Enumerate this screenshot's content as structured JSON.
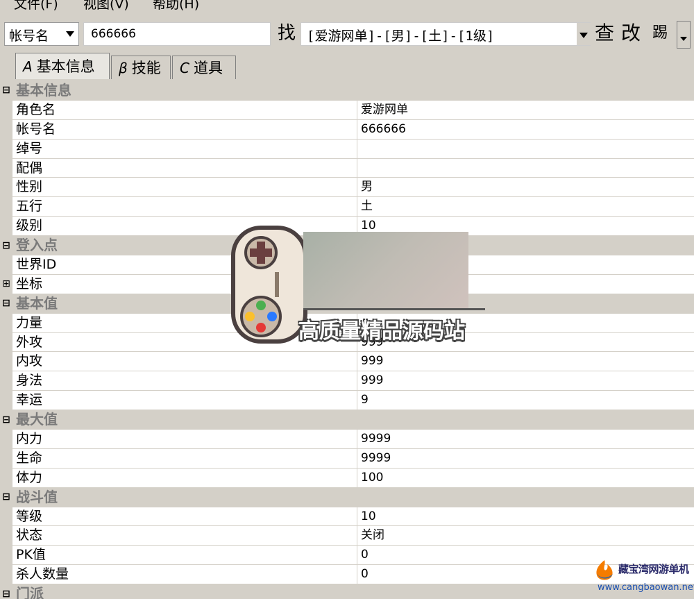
{
  "menu": [
    {
      "label": "文件(F)"
    },
    {
      "label": "视图(V)"
    },
    {
      "label": "帮助(H)"
    }
  ],
  "toolbar": {
    "search_type": "帐号名",
    "account_value": "666666",
    "find_label": "找",
    "role_selected": "[爱游网单]-[男]-[土]-[1级]",
    "query_label": "查",
    "modify_label": "改",
    "extra_label": "踢"
  },
  "tabs": [
    {
      "label": "基本信息",
      "icon": "person-icon",
      "active": true
    },
    {
      "label": "技能",
      "icon": "skill-icon",
      "active": false
    },
    {
      "label": "道具",
      "icon": "item-icon",
      "active": false
    }
  ],
  "grid": {
    "rows": [
      {
        "type": "category",
        "expander": "⊟",
        "name": "基本信息"
      },
      {
        "type": "prop",
        "name": "角色名",
        "value": "爱游网单"
      },
      {
        "type": "prop",
        "name": "帐号名",
        "value": "666666"
      },
      {
        "type": "prop",
        "name": "绰号",
        "value": ""
      },
      {
        "type": "prop",
        "name": "配偶",
        "value": ""
      },
      {
        "type": "prop",
        "name": "性别",
        "value": "男"
      },
      {
        "type": "prop",
        "name": "五行",
        "value": "土"
      },
      {
        "type": "prop",
        "name": "级别",
        "value": "10"
      },
      {
        "type": "category",
        "expander": "⊟",
        "name": "登入点"
      },
      {
        "type": "prop",
        "name": "世界ID",
        "value": ""
      },
      {
        "type": "prop",
        "expander": "⊞",
        "name": "坐标",
        "value": ""
      },
      {
        "type": "category",
        "expander": "⊟",
        "name": "基本值"
      },
      {
        "type": "prop",
        "name": "力量",
        "value": ""
      },
      {
        "type": "prop",
        "name": "外攻",
        "value": "999"
      },
      {
        "type": "prop",
        "name": "内攻",
        "value": "999"
      },
      {
        "type": "prop",
        "name": "身法",
        "value": "999"
      },
      {
        "type": "prop",
        "name": "幸运",
        "value": "9"
      },
      {
        "type": "category",
        "expander": "⊟",
        "name": "最大值"
      },
      {
        "type": "prop",
        "name": "内力",
        "value": "9999"
      },
      {
        "type": "prop",
        "name": "生命",
        "value": "9999"
      },
      {
        "type": "prop",
        "name": "体力",
        "value": "100"
      },
      {
        "type": "category",
        "expander": "⊟",
        "name": "战斗值"
      },
      {
        "type": "prop",
        "name": "等级",
        "value": "10"
      },
      {
        "type": "prop",
        "name": "状态",
        "value": "关闭"
      },
      {
        "type": "prop",
        "name": "PK值",
        "value": "0"
      },
      {
        "type": "prop",
        "name": "杀人数量",
        "value": "0"
      },
      {
        "type": "category",
        "expander": "⊟",
        "name": "门派"
      }
    ]
  },
  "watermark": {
    "caption": "高质量精品源码站",
    "brand_title": "藏宝湾网游单机",
    "brand_url": "www.cangbaowan.net"
  }
}
